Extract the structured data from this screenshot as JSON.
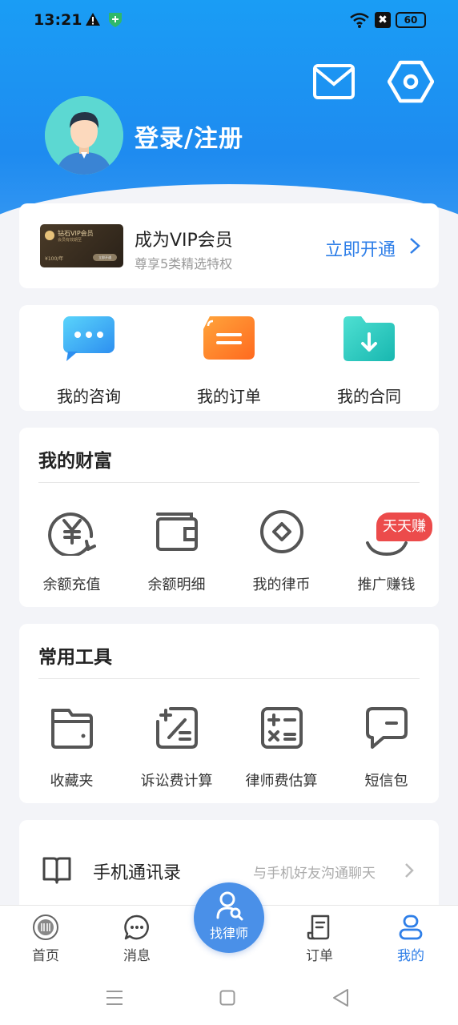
{
  "status": {
    "time": "13:21",
    "battery": "60",
    "x_badge": "✖"
  },
  "profile": {
    "login_label": "登录/注册"
  },
  "vip": {
    "title": "成为VIP会员",
    "subtitle": "尊享5类精选特权",
    "action": "立即开通",
    "card": {
      "name": "钻石VIP会员",
      "sub": "会员有效期至",
      "price": "¥100/年",
      "btn": "立即开通"
    }
  },
  "quick": [
    {
      "label": "我的咨询",
      "icon": "chat-bubble-icon"
    },
    {
      "label": "我的订单",
      "icon": "order-list-icon"
    },
    {
      "label": "我的合同",
      "icon": "folder-download-icon"
    }
  ],
  "wealth": {
    "title": "我的财富",
    "items": [
      {
        "label": "余额充值",
        "icon": "yuan-recharge-icon"
      },
      {
        "label": "余额明细",
        "icon": "wallet-icon"
      },
      {
        "label": "我的律币",
        "icon": "coin-icon"
      },
      {
        "label": "推广赚钱",
        "icon": "promote-icon"
      }
    ],
    "badge": "天天赚"
  },
  "tools": {
    "title": "常用工具",
    "items": [
      {
        "label": "收藏夹",
        "icon": "favorites-folder-icon"
      },
      {
        "label": "诉讼费计算",
        "icon": "litigation-calculator-icon"
      },
      {
        "label": "律师费估算",
        "icon": "lawyer-fee-calculator-icon"
      },
      {
        "label": "短信包",
        "icon": "sms-icon"
      }
    ]
  },
  "contacts": {
    "label": "手机通讯录",
    "hint": "与手机好友沟通聊天"
  },
  "tabs": [
    {
      "label": "首页",
      "icon": "home-emblem-icon",
      "active": false
    },
    {
      "label": "消息",
      "icon": "message-icon",
      "active": false
    },
    {
      "label": "找律师",
      "icon": "find-lawyer-icon",
      "active": false
    },
    {
      "label": "订单",
      "icon": "order-icon",
      "active": false
    },
    {
      "label": "我的",
      "icon": "profile-icon",
      "active": true
    }
  ],
  "colors": {
    "primary": "#2f7fe8",
    "header": "#1a9df5",
    "badge": "#ec4b4b"
  }
}
